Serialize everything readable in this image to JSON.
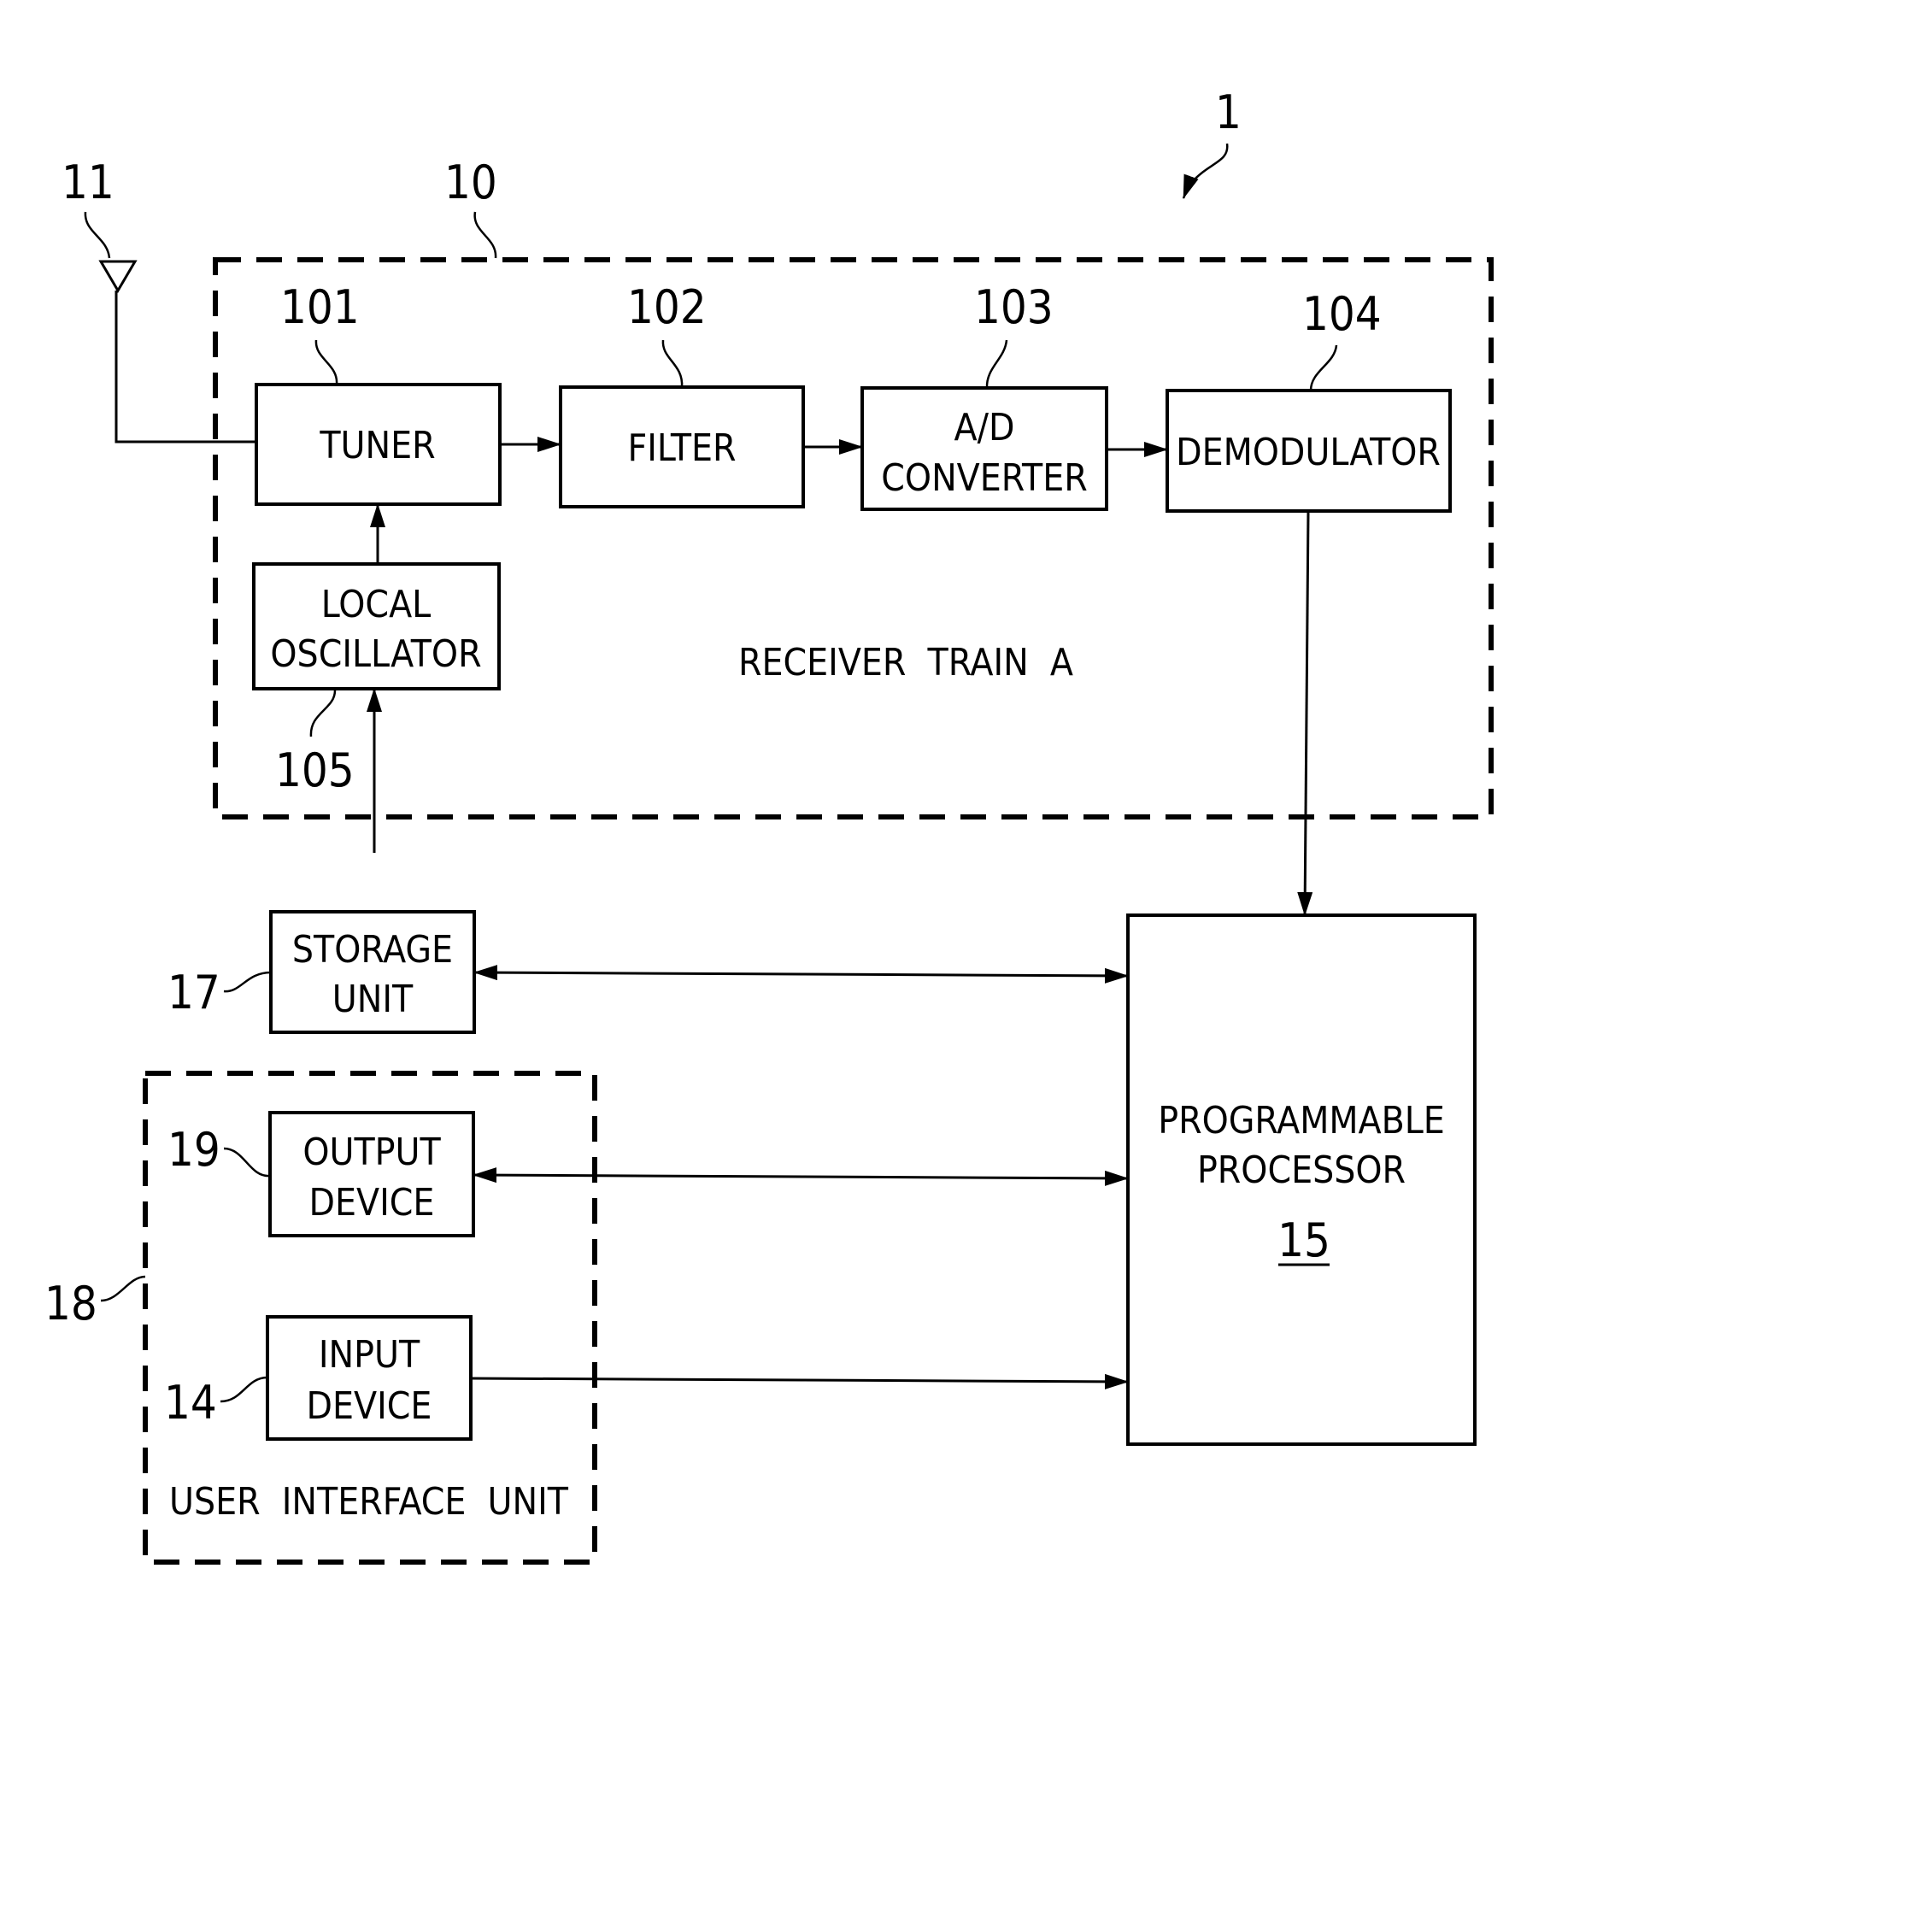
{
  "figure": {
    "ref_system": "1",
    "receiver_train": {
      "ref": "10",
      "label": "RECEIVER  TRAIN  A"
    },
    "antenna": {
      "ref": "11"
    },
    "blocks": {
      "tuner": {
        "ref": "101",
        "lines": [
          "TUNER"
        ]
      },
      "filter": {
        "ref": "102",
        "lines": [
          "FILTER"
        ]
      },
      "adc": {
        "ref": "103",
        "lines": [
          "A/D",
          "CONVERTER"
        ]
      },
      "demodulator": {
        "ref": "104",
        "lines": [
          "DEMODULATOR"
        ]
      },
      "local_oscillator": {
        "ref": "105",
        "lines": [
          "LOCAL",
          "OSCILLATOR"
        ]
      },
      "storage": {
        "ref": "17",
        "lines": [
          "STORAGE",
          "UNIT"
        ]
      },
      "output_device": {
        "ref": "19",
        "lines": [
          "OUTPUT",
          "DEVICE"
        ]
      },
      "input_device": {
        "ref": "14",
        "lines": [
          "INPUT",
          "DEVICE"
        ]
      },
      "processor": {
        "ref": "15",
        "lines": [
          "PROGRAMMABLE",
          "PROCESSOR"
        ]
      }
    },
    "user_interface": {
      "ref": "18",
      "label": "USER  INTERFACE  UNIT"
    }
  }
}
